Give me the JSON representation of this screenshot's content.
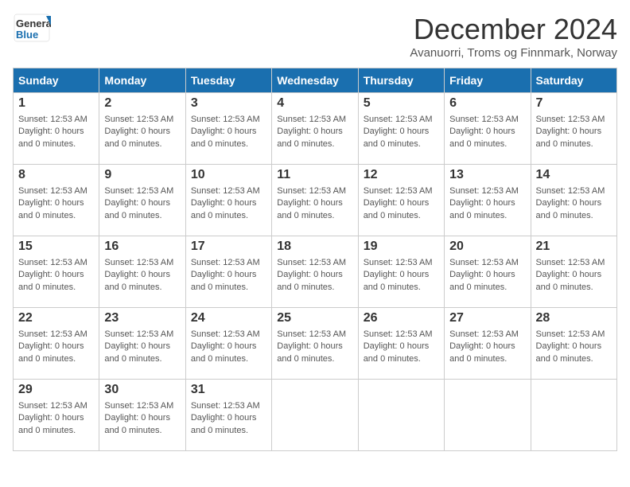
{
  "logo": {
    "line1": "General",
    "line2": "Blue"
  },
  "title": "December 2024",
  "subtitle": "Avanuorri, Troms og Finnmark, Norway",
  "days_of_week": [
    "Sunday",
    "Monday",
    "Tuesday",
    "Wednesday",
    "Thursday",
    "Friday",
    "Saturday"
  ],
  "default_info": "Sunset: 12:53 AM\nDaylight: 0 hours and 0 minutes.",
  "weeks": [
    [
      {
        "day": "1",
        "info": "Sunset: 12:53 AM\nDaylight: 0 hours\nand 0 minutes."
      },
      {
        "day": "2",
        "info": "Sunset: 12:53 AM\nDaylight: 0 hours\nand 0 minutes."
      },
      {
        "day": "3",
        "info": "Sunset: 12:53 AM\nDaylight: 0 hours\nand 0 minutes."
      },
      {
        "day": "4",
        "info": "Sunset: 12:53 AM\nDaylight: 0 hours\nand 0 minutes."
      },
      {
        "day": "5",
        "info": "Sunset: 12:53 AM\nDaylight: 0 hours\nand 0 minutes."
      },
      {
        "day": "6",
        "info": "Sunset: 12:53 AM\nDaylight: 0 hours\nand 0 minutes."
      },
      {
        "day": "7",
        "info": "Sunset: 12:53 AM\nDaylight: 0 hours\nand 0 minutes."
      }
    ],
    [
      {
        "day": "8",
        "info": "Sunset: 12:53 AM\nDaylight: 0 hours\nand 0 minutes."
      },
      {
        "day": "9",
        "info": "Sunset: 12:53 AM\nDaylight: 0 hours\nand 0 minutes."
      },
      {
        "day": "10",
        "info": "Sunset: 12:53 AM\nDaylight: 0 hours\nand 0 minutes."
      },
      {
        "day": "11",
        "info": "Sunset: 12:53 AM\nDaylight: 0 hours\nand 0 minutes."
      },
      {
        "day": "12",
        "info": "Sunset: 12:53 AM\nDaylight: 0 hours\nand 0 minutes."
      },
      {
        "day": "13",
        "info": "Sunset: 12:53 AM\nDaylight: 0 hours\nand 0 minutes."
      },
      {
        "day": "14",
        "info": "Sunset: 12:53 AM\nDaylight: 0 hours\nand 0 minutes."
      }
    ],
    [
      {
        "day": "15",
        "info": "Sunset: 12:53 AM\nDaylight: 0 hours\nand 0 minutes."
      },
      {
        "day": "16",
        "info": "Sunset: 12:53 AM\nDaylight: 0 hours\nand 0 minutes."
      },
      {
        "day": "17",
        "info": "Sunset: 12:53 AM\nDaylight: 0 hours\nand 0 minutes."
      },
      {
        "day": "18",
        "info": "Sunset: 12:53 AM\nDaylight: 0 hours\nand 0 minutes."
      },
      {
        "day": "19",
        "info": "Sunset: 12:53 AM\nDaylight: 0 hours\nand 0 minutes."
      },
      {
        "day": "20",
        "info": "Sunset: 12:53 AM\nDaylight: 0 hours\nand 0 minutes."
      },
      {
        "day": "21",
        "info": "Sunset: 12:53 AM\nDaylight: 0 hours\nand 0 minutes."
      }
    ],
    [
      {
        "day": "22",
        "info": "Sunset: 12:53 AM\nDaylight: 0 hours\nand 0 minutes."
      },
      {
        "day": "23",
        "info": "Sunset: 12:53 AM\nDaylight: 0 hours\nand 0 minutes."
      },
      {
        "day": "24",
        "info": "Sunset: 12:53 AM\nDaylight: 0 hours\nand 0 minutes."
      },
      {
        "day": "25",
        "info": "Sunset: 12:53 AM\nDaylight: 0 hours\nand 0 minutes."
      },
      {
        "day": "26",
        "info": "Sunset: 12:53 AM\nDaylight: 0 hours\nand 0 minutes."
      },
      {
        "day": "27",
        "info": "Sunset: 12:53 AM\nDaylight: 0 hours\nand 0 minutes."
      },
      {
        "day": "28",
        "info": "Sunset: 12:53 AM\nDaylight: 0 hours\nand 0 minutes."
      }
    ],
    [
      {
        "day": "29",
        "info": "Sunset: 12:53 AM\nDaylight: 0 hours\nand 0 minutes."
      },
      {
        "day": "30",
        "info": "Sunset: 12:53 AM\nDaylight: 0 hours\nand 0 minutes."
      },
      {
        "day": "31",
        "info": "Sunset: 12:53 AM\nDaylight: 0 hours\nand 0 minutes."
      },
      {
        "day": "",
        "info": ""
      },
      {
        "day": "",
        "info": ""
      },
      {
        "day": "",
        "info": ""
      },
      {
        "day": "",
        "info": ""
      }
    ]
  ]
}
